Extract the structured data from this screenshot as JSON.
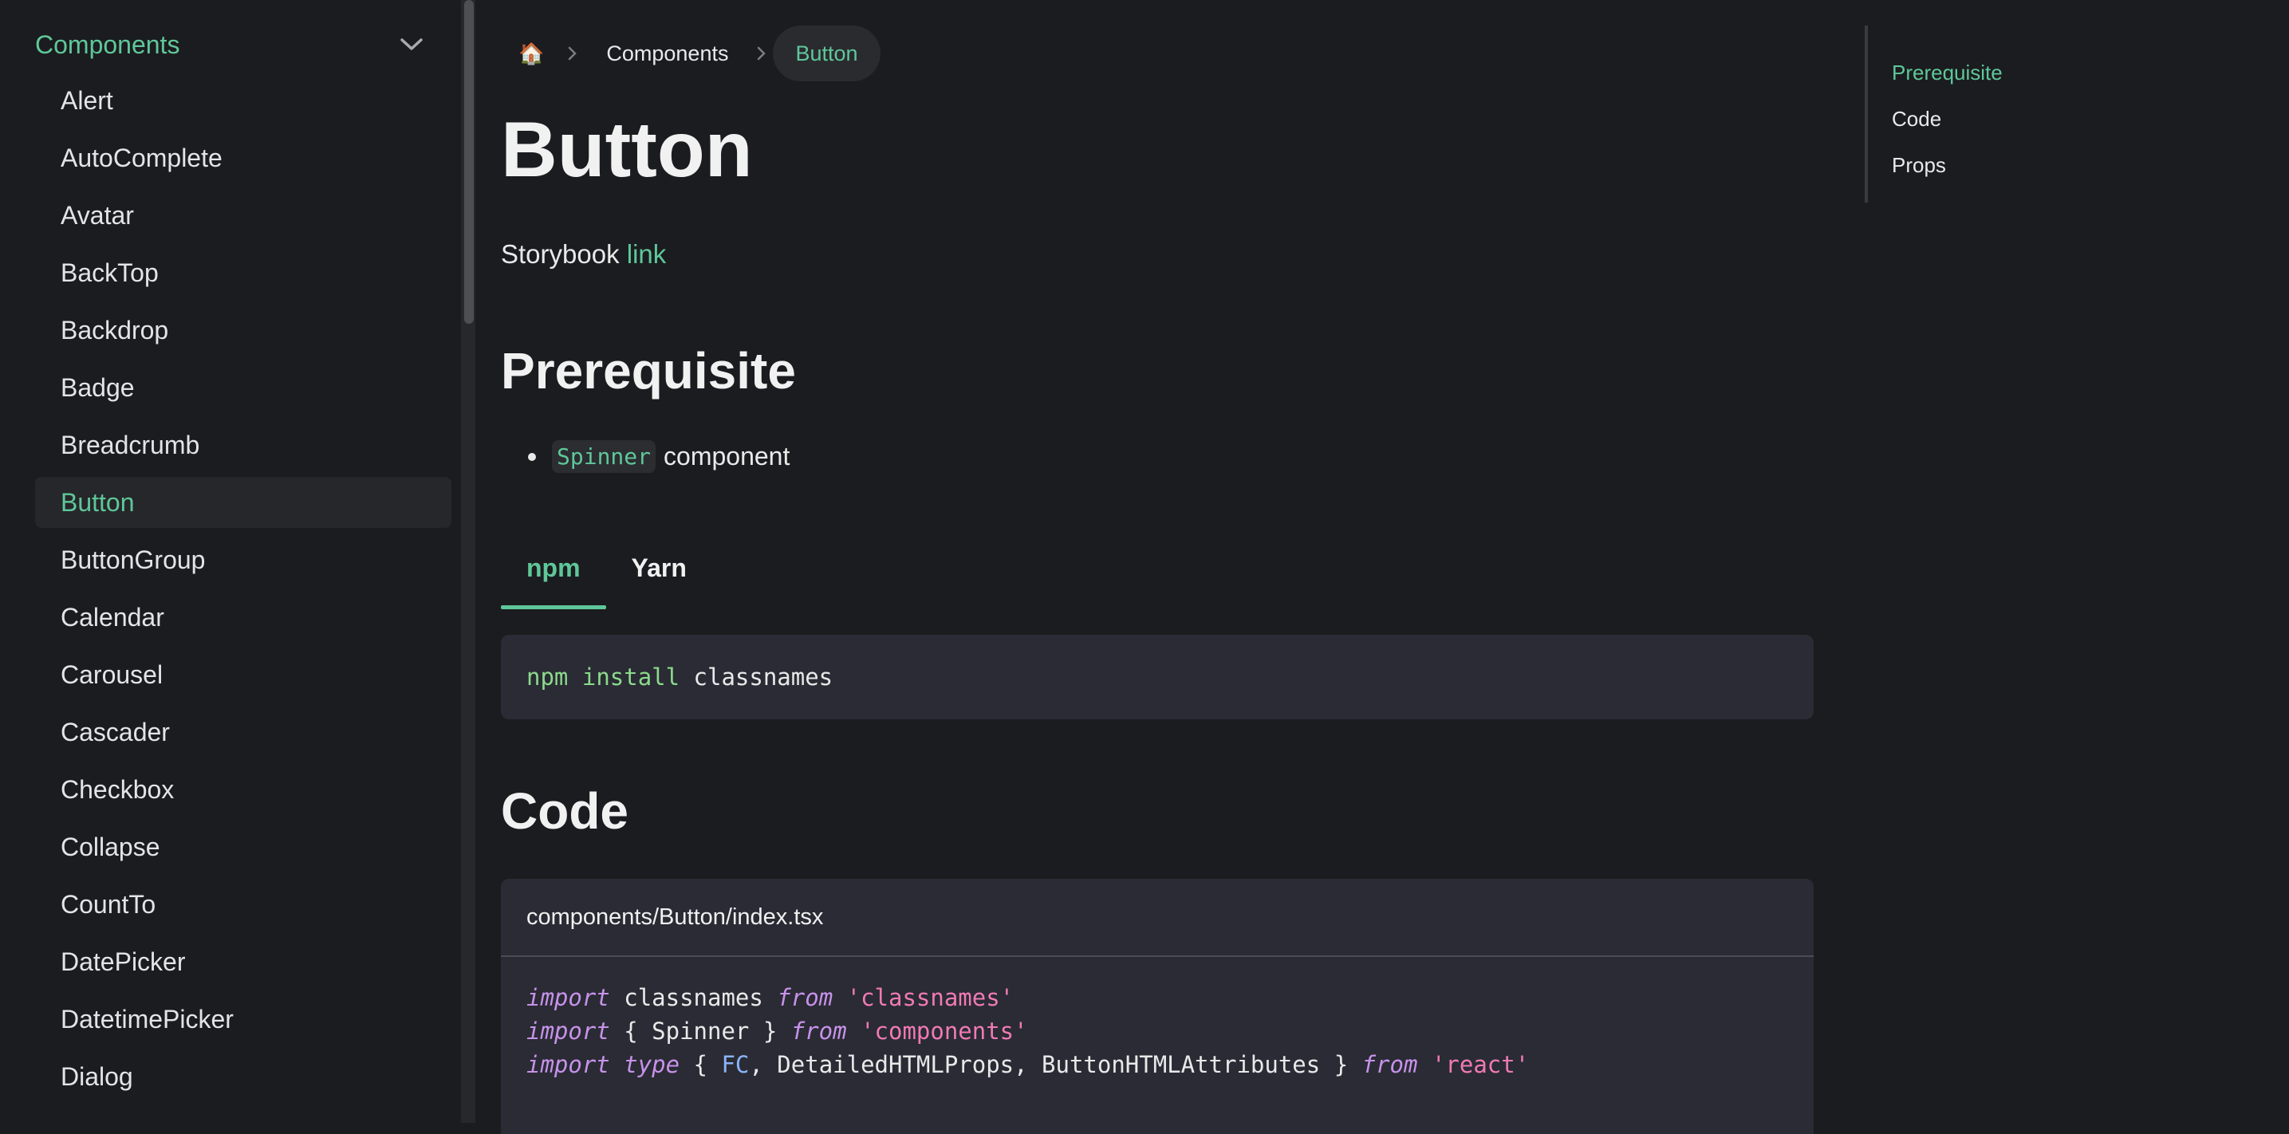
{
  "sidebar": {
    "section_title": "Components",
    "items": [
      {
        "label": "Alert"
      },
      {
        "label": "AutoComplete"
      },
      {
        "label": "Avatar"
      },
      {
        "label": "BackTop"
      },
      {
        "label": "Backdrop"
      },
      {
        "label": "Badge"
      },
      {
        "label": "Breadcrumb"
      },
      {
        "label": "Button",
        "active": true
      },
      {
        "label": "ButtonGroup"
      },
      {
        "label": "Calendar"
      },
      {
        "label": "Carousel"
      },
      {
        "label": "Cascader"
      },
      {
        "label": "Checkbox"
      },
      {
        "label": "Collapse"
      },
      {
        "label": "CountTo"
      },
      {
        "label": "DatePicker"
      },
      {
        "label": "DatetimePicker"
      },
      {
        "label": "Dialog"
      }
    ]
  },
  "breadcrumb": {
    "home_icon": "🏠",
    "items": [
      "Components",
      "Button"
    ]
  },
  "page": {
    "title": "Button",
    "storybook_text": "Storybook",
    "storybook_link": "link",
    "prerequisite_heading": "Prerequisite",
    "prerequisite_code": "Spinner",
    "prerequisite_text": "component",
    "tabs": [
      "npm",
      "Yarn"
    ],
    "install_cmd": {
      "cmd": "npm",
      "sub": "install",
      "pkg": "classnames"
    },
    "code_heading": "Code",
    "filename": "components/Button/index.tsx"
  },
  "toc": {
    "items": [
      "Prerequisite",
      "Code",
      "Props"
    ]
  },
  "colors": {
    "accent": "#5fc79a",
    "background": "#1b1c1f",
    "code_bg": "#2a2b34"
  }
}
